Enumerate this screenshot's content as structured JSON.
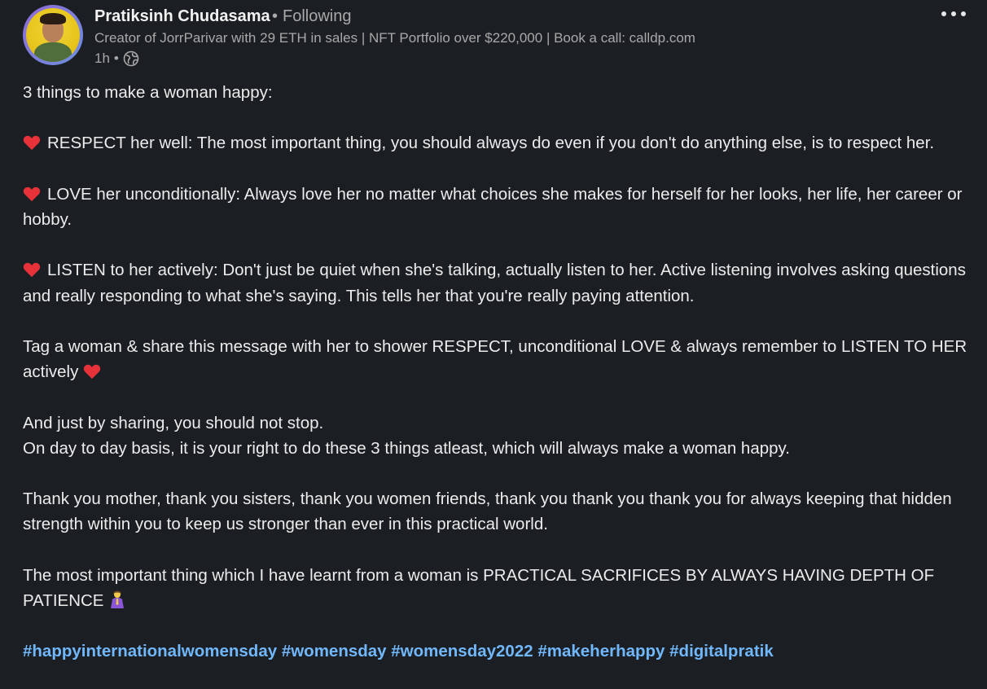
{
  "author": {
    "name": "Pratiksinh Chudasama",
    "follow_status": "Following",
    "headline": "Creator of JorrParivar with 29 ETH in sales | NFT Portfolio over $220,000 | Book a call: calldp.com",
    "time": "1h",
    "visibility_icon": "globe-icon"
  },
  "menu": {
    "more_icon": "more-horizontal-icon"
  },
  "post": {
    "intro": "3 things to make a woman happy:",
    "point1_icon": "red-heart-icon",
    "point1": "RESPECT her well: The most important thing, you should always do even if you don't do anything else, is to respect her.",
    "point2_icon": "red-heart-icon",
    "point2": "LOVE her unconditionally: Always love her no matter what choices she makes for herself for her looks, her life, her career or hobby.",
    "point3_icon": "red-heart-icon",
    "point3": "LISTEN to her actively: Don't just be quiet when she's talking, actually listen to her. Active listening involves asking questions and really responding to what she's saying. This tells her that you're really paying attention.",
    "tag_call": "Tag a woman & share this message with her to shower RESPECT, unconditional LOVE & always remember to LISTEN TO HER actively",
    "tag_call_icon": "red-heart-icon",
    "sharing_line1": "And just by sharing, you should not stop.",
    "sharing_line2": "On day to day basis, it is your right to do these 3 things atleast, which will always make a woman happy.",
    "thanks": "Thank you mother, thank you sisters, thank you women friends, thank you thank you thank you for always keeping that hidden strength within you to keep us stronger than ever in this practical world.",
    "lesson": "The most important thing which I have learnt from a woman is PRACTICAL SACRIFICES BY ALWAYS HAVING DEPTH OF PATIENCE",
    "lesson_icon": "praying-woman-icon",
    "hashtags": [
      "#happyinternationalwomensday",
      "#womensday",
      "#womensday2022",
      "#makeherhappy",
      "#digitalpratik"
    ]
  },
  "colors": {
    "background": "#1b1f23",
    "text": "#ececec",
    "muted": "#a8a8a8",
    "hashtag": "#71b7fb",
    "heart": "#e8323a"
  }
}
